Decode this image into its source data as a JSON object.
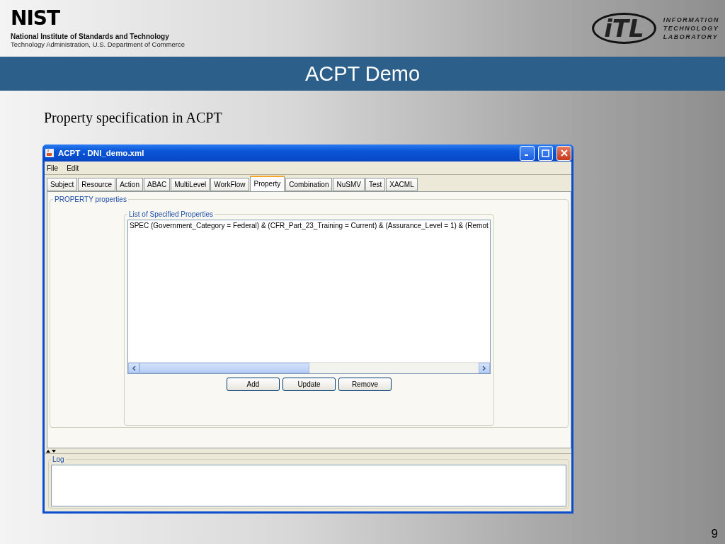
{
  "header": {
    "logo": "NIST",
    "org_name": "National Institute of Standards and Technology",
    "org_sub": "Technology Administration, U.S. Department of Commerce",
    "lab_logo": "iTL",
    "lab_name": [
      "INFORMATION",
      "TECHNOLOGY",
      "LABORATORY"
    ]
  },
  "title": "ACPT Demo",
  "subtitle": "Property specification in ACPT",
  "window": {
    "title": "ACPT - DNI_demo.xml",
    "menu": [
      "File",
      "Edit"
    ],
    "tabs": [
      {
        "label": "Subject",
        "selected": false
      },
      {
        "label": "Resource",
        "selected": false
      },
      {
        "label": "Action",
        "selected": false
      },
      {
        "label": "ABAC",
        "selected": false
      },
      {
        "label": "MultiLevel",
        "selected": false
      },
      {
        "label": "WorkFlow",
        "selected": false
      },
      {
        "label": "Property",
        "selected": true
      },
      {
        "label": "Combination",
        "selected": false
      },
      {
        "label": "NuSMV",
        "selected": false
      },
      {
        "label": "Test",
        "selected": false
      },
      {
        "label": "XACML",
        "selected": false
      }
    ],
    "panel_title": "PROPERTY properties",
    "list_title": "List of Specified Properties",
    "list_items": [
      "SPEC (Government_Category = Federal) & (CFR_Part_23_Training = Current) & (Assurance_Level = 1) & (Remot"
    ],
    "buttons": [
      "Add",
      "Update",
      "Remove"
    ],
    "log_title": "Log"
  },
  "page_number": "9"
}
